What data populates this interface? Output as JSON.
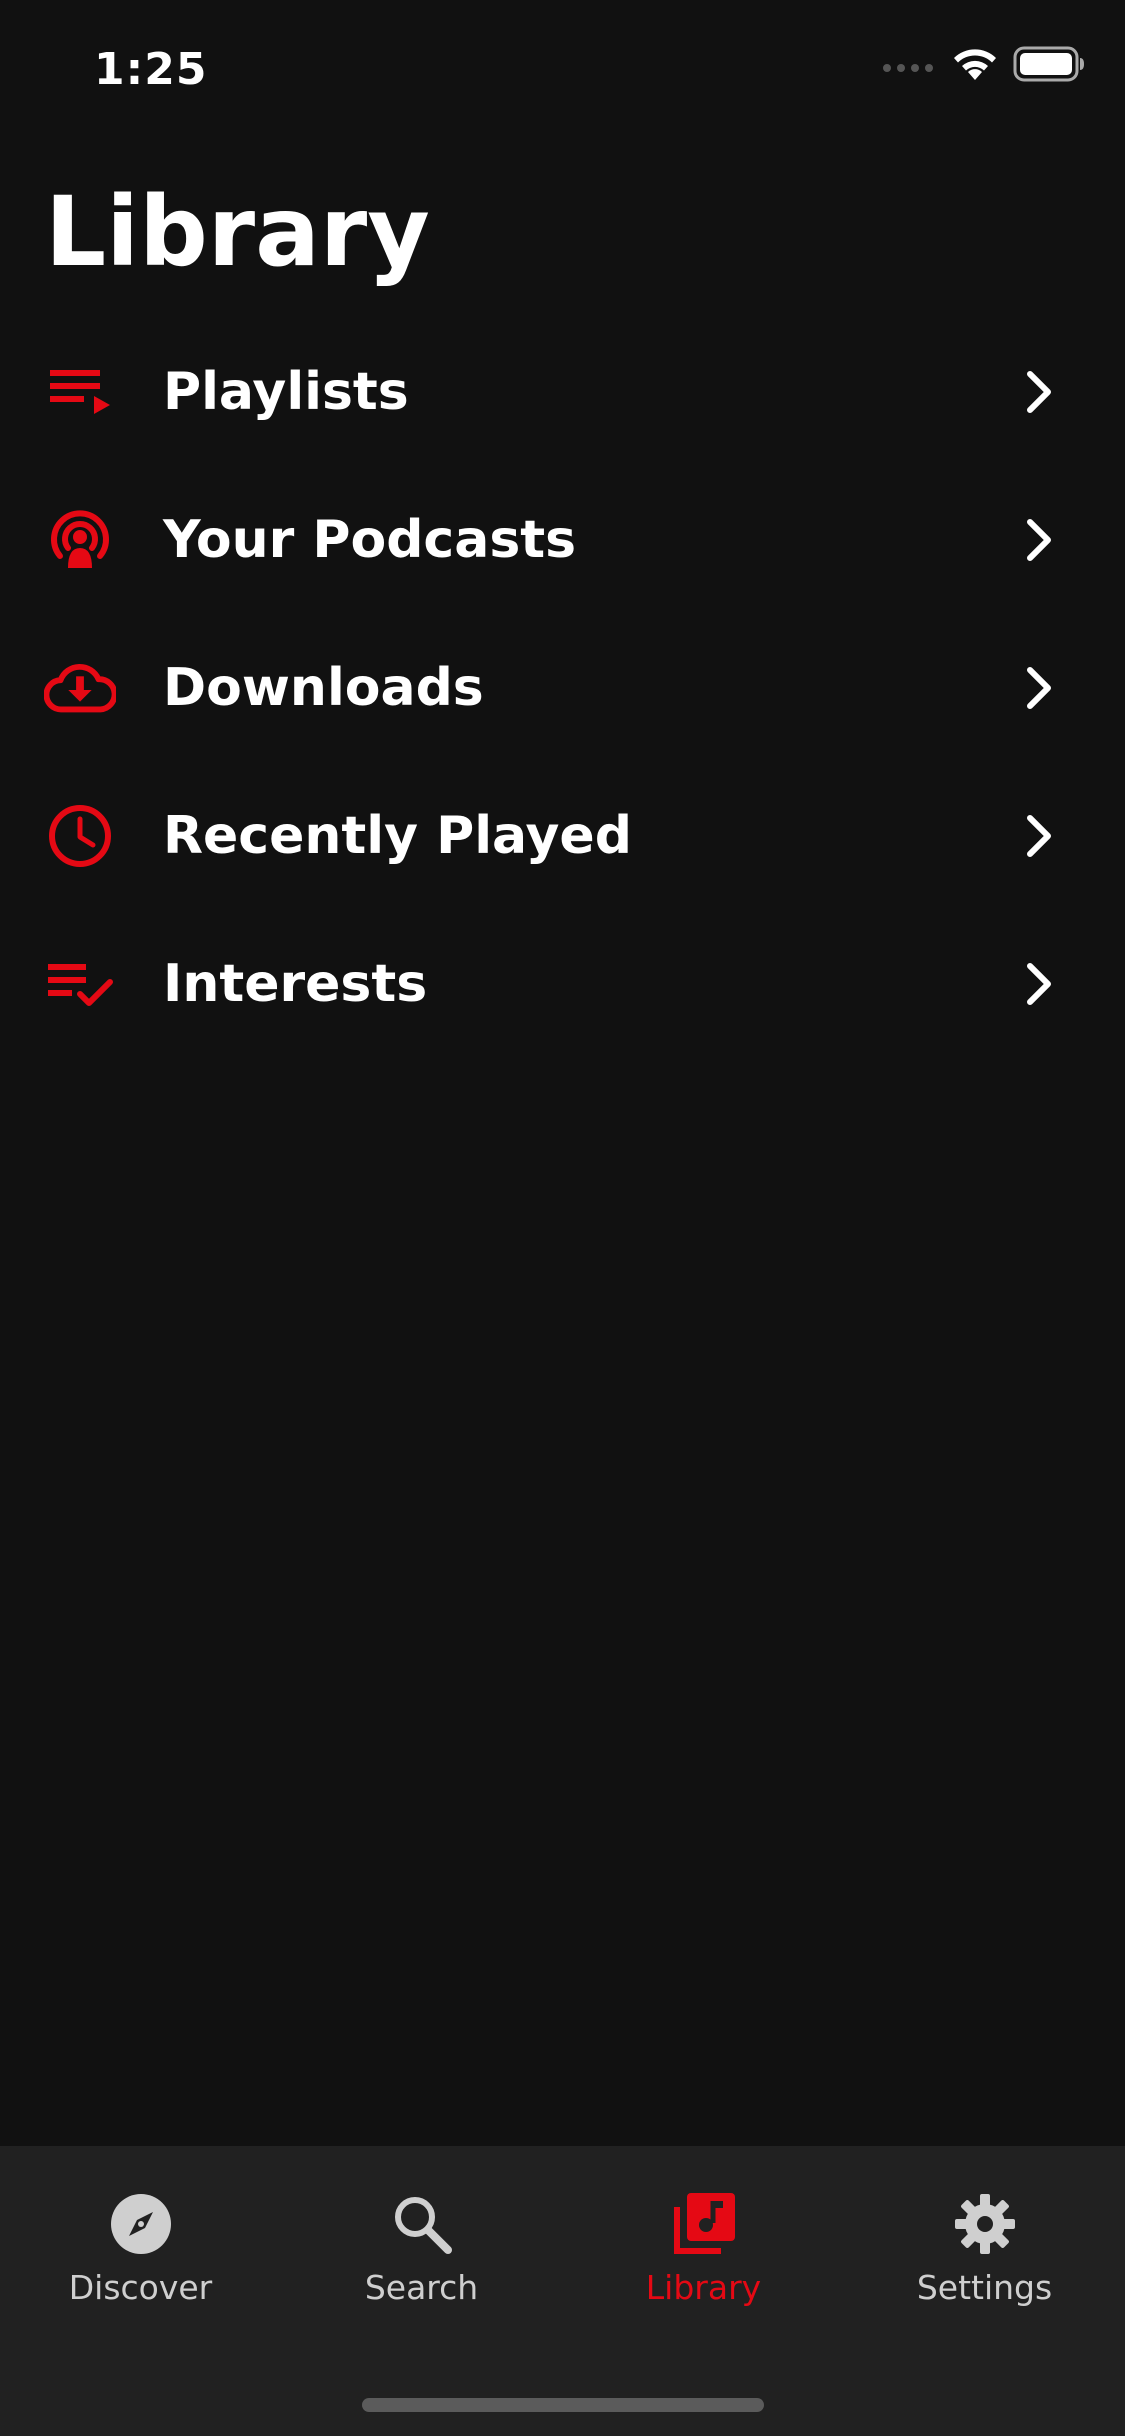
{
  "status_bar": {
    "time": "1:25"
  },
  "page": {
    "title": "Library"
  },
  "colors": {
    "accent": "#e50914",
    "background": "#111111",
    "tab_bar": "#212121",
    "text": "#ffffff",
    "tab_inactive": "#cfcfcf"
  },
  "menu": {
    "items": [
      {
        "label": "Playlists",
        "icon": "playlist-play-icon"
      },
      {
        "label": "Your Podcasts",
        "icon": "podcast-icon"
      },
      {
        "label": "Downloads",
        "icon": "cloud-download-icon"
      },
      {
        "label": "Recently Played",
        "icon": "clock-icon"
      },
      {
        "label": "Interests",
        "icon": "playlist-check-icon"
      }
    ]
  },
  "tabs": [
    {
      "label": "Discover",
      "icon": "compass-icon",
      "active": false
    },
    {
      "label": "Search",
      "icon": "search-icon",
      "active": false
    },
    {
      "label": "Library",
      "icon": "library-music-icon",
      "active": true
    },
    {
      "label": "Settings",
      "icon": "gear-icon",
      "active": false
    }
  ]
}
